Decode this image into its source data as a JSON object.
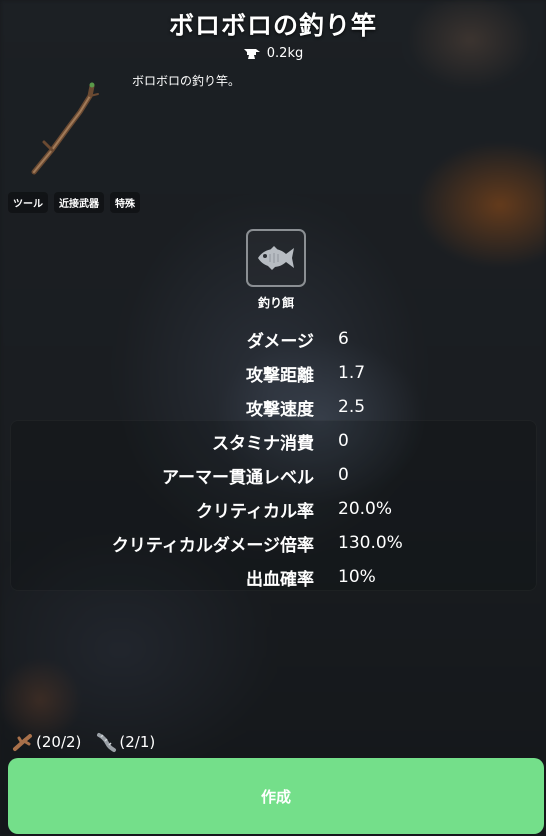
{
  "item": {
    "title": "ボロボロの釣り竿",
    "weight": "0.2kg",
    "description": "ボロボロの釣り竿。",
    "icon": "stick-rod-icon",
    "tags": [
      "ツール",
      "近接武器",
      "特殊"
    ]
  },
  "bait": {
    "label": "釣り餌",
    "icon": "fish-icon"
  },
  "stats": [
    {
      "label": "ダメージ",
      "value": "6"
    },
    {
      "label": "攻撃距離",
      "value": "1.7"
    },
    {
      "label": "攻撃速度",
      "value": "2.5"
    },
    {
      "label": "スタミナ消費",
      "value": "0"
    },
    {
      "label": "アーマー貫通レベル",
      "value": "0"
    },
    {
      "label": "クリティカル率",
      "value": "20.0%"
    },
    {
      "label": "クリティカルダメージ倍率",
      "value": "130.0%"
    },
    {
      "label": "出血確率",
      "value": "10%"
    }
  ],
  "materials": [
    {
      "icon": "branch-icon",
      "count": "(20/2)"
    },
    {
      "icon": "fiber-icon",
      "count": "(2/1)"
    }
  ],
  "craft": {
    "label": "作成"
  },
  "colors": {
    "craft_button": "#74df8a",
    "text": "#ffffff"
  }
}
